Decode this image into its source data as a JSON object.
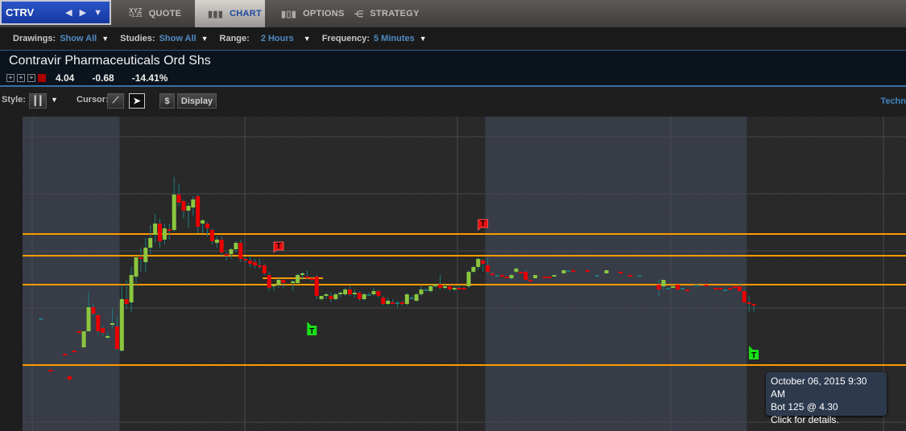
{
  "symbol": "CTRV",
  "tabs": [
    {
      "label": "QUOTE",
      "icon_top": "XYZ",
      "icon_bottom": "+1.21"
    },
    {
      "label": "CHART"
    },
    {
      "label": "OPTIONS"
    },
    {
      "label": "STRATEGY"
    }
  ],
  "toolbar": {
    "drawings_label": "Drawings:",
    "drawings_value": "Show All",
    "studies_label": "Studies:",
    "studies_value": "Show All",
    "range_label": "Range:",
    "range_value": "2 Hours",
    "frequency_label": "Frequency:",
    "frequency_value": "5 Minutes"
  },
  "security": {
    "name": "Contravir Pharmaceuticals Ord Shs",
    "last": "4.04",
    "change": "-0.68",
    "pct_change": "-14.41%"
  },
  "chart_toolbar": {
    "style_label": "Style:",
    "cursor_label": "Cursor:",
    "dollar": "$",
    "display_label": "Display",
    "right_label": "Techn"
  },
  "tooltip": {
    "line1": "October 06, 2015 9:30 AM",
    "line2": "Bot 125 @ 4.30",
    "line3": "Click for details."
  },
  "colors": {
    "up": "#8cc63f",
    "down": "#e80000",
    "wick": "#1d7b7e",
    "level": "#ff9a00",
    "trade_sell": "#e81010",
    "trade_buy": "#19e019"
  },
  "chart_data": {
    "type": "candlestick",
    "frequency_minutes": 5,
    "candles": [
      [
        0,
        3.96,
        3.96,
        3.96,
        3.96
      ],
      [
        2,
        3.64,
        3.64,
        3.64,
        3.64
      ],
      [
        5,
        3.74,
        3.74,
        3.74,
        3.74
      ],
      [
        6,
        3.6,
        3.6,
        3.58,
        3.58
      ],
      [
        7,
        3.76,
        3.76,
        3.76,
        3.76
      ],
      [
        8,
        3.88,
        3.88,
        3.88,
        3.88
      ],
      [
        9,
        3.78,
        3.88,
        3.78,
        3.88
      ],
      [
        10,
        3.88,
        4.13,
        3.88,
        4.03
      ],
      [
        11,
        4.03,
        4.05,
        3.98,
        3.99
      ],
      [
        12,
        3.98,
        3.99,
        3.86,
        3.88
      ],
      [
        13,
        3.9,
        3.91,
        3.85,
        3.87
      ],
      [
        14,
        3.84,
        3.87,
        3.83,
        3.85
      ],
      [
        15,
        3.92,
        4.02,
        3.9,
        3.93
      ],
      [
        16,
        3.91,
        3.97,
        3.76,
        3.77
      ],
      [
        17,
        3.76,
        4.17,
        3.75,
        4.08
      ],
      [
        18,
        4.08,
        4.2,
        4.02,
        4.05
      ],
      [
        19,
        4.06,
        4.28,
        4.0,
        4.23
      ],
      [
        20,
        4.22,
        4.27,
        4.16,
        4.34
      ],
      [
        21,
        4.34,
        4.4,
        4.25,
        4.33
      ],
      [
        22,
        4.31,
        4.46,
        4.25,
        4.4
      ],
      [
        23,
        4.4,
        4.54,
        4.36,
        4.46
      ],
      [
        24,
        4.48,
        4.61,
        4.43,
        4.55
      ],
      [
        25,
        4.55,
        4.58,
        4.4,
        4.44
      ],
      [
        26,
        4.45,
        4.55,
        4.42,
        4.52
      ],
      [
        27,
        4.515,
        4.55,
        4.45,
        4.51
      ],
      [
        28,
        4.51,
        4.84,
        4.5,
        4.73
      ],
      [
        29,
        4.73,
        4.8,
        4.66,
        4.68
      ],
      [
        30,
        4.69,
        4.7,
        4.58,
        4.63
      ],
      [
        31,
        4.63,
        4.68,
        4.52,
        4.66
      ],
      [
        32,
        4.65,
        4.72,
        4.6,
        4.7
      ],
      [
        33,
        4.72,
        4.73,
        4.49,
        4.53
      ],
      [
        34,
        4.55,
        4.58,
        4.49,
        4.57
      ],
      [
        35,
        4.55,
        4.56,
        4.47,
        4.52
      ],
      [
        36,
        4.51,
        4.52,
        4.42,
        4.44
      ],
      [
        37,
        4.43,
        4.47,
        4.4,
        4.45
      ],
      [
        38,
        4.45,
        4.47,
        4.35,
        4.37
      ],
      [
        39,
        4.36,
        4.37,
        4.32,
        4.35
      ],
      [
        40,
        4.36,
        4.4,
        4.33,
        4.39
      ],
      [
        41,
        4.39,
        4.44,
        4.37,
        4.43
      ],
      [
        42,
        4.43,
        4.45,
        4.31,
        4.33
      ],
      [
        43,
        4.33,
        4.34,
        4.31,
        4.32
      ],
      [
        44,
        4.32,
        4.35,
        4.28,
        4.3
      ],
      [
        45,
        4.31,
        4.33,
        4.27,
        4.29
      ],
      [
        46,
        4.29,
        4.33,
        4.27,
        4.28
      ],
      [
        47,
        4.29,
        4.3,
        4.23,
        4.24
      ],
      [
        48,
        4.23,
        4.25,
        4.13,
        4.15
      ],
      [
        49,
        4.16,
        4.17,
        4.13,
        4.17
      ],
      [
        50,
        4.17,
        4.21,
        4.15,
        4.2
      ],
      [
        51,
        4.2,
        4.21,
        4.15,
        4.18
      ],
      [
        53,
        4.18,
        4.2,
        4.13,
        4.19
      ],
      [
        54,
        4.18,
        4.24,
        4.17,
        4.23
      ],
      [
        55,
        4.23,
        4.25,
        4.2,
        4.24
      ],
      [
        56,
        4.22,
        4.26,
        4.2,
        4.21
      ],
      [
        57,
        4.21,
        4.22,
        4.19,
        4.2
      ],
      [
        58,
        4.22,
        4.23,
        4.08,
        4.1
      ],
      [
        59,
        4.08,
        4.1,
        4.07,
        4.1
      ],
      [
        60,
        4.1,
        4.12,
        4.08,
        4.11
      ],
      [
        61,
        4.1,
        4.12,
        4.06,
        4.08
      ],
      [
        62,
        4.08,
        4.12,
        4.07,
        4.11
      ],
      [
        63,
        4.11,
        4.13,
        4.09,
        4.12
      ],
      [
        64,
        4.11,
        4.15,
        4.1,
        4.14
      ],
      [
        65,
        4.14,
        4.16,
        4.1,
        4.11
      ],
      [
        66,
        4.11,
        4.14,
        4.09,
        4.12
      ],
      [
        67,
        4.12,
        4.13,
        4.07,
        4.08
      ],
      [
        68,
        4.08,
        4.12,
        4.07,
        4.11
      ],
      [
        69,
        4.11,
        4.12,
        4.1,
        4.11
      ],
      [
        70,
        4.11,
        4.15,
        4.1,
        4.13
      ],
      [
        71,
        4.13,
        4.14,
        4.09,
        4.1
      ],
      [
        72,
        4.09,
        4.1,
        4.04,
        4.05
      ],
      [
        73,
        4.05,
        4.09,
        4.04,
        4.07
      ],
      [
        74,
        4.06,
        4.08,
        4.05,
        4.06
      ],
      [
        75,
        4.06,
        4.07,
        4.03,
        4.06
      ],
      [
        76,
        4.06,
        4.07,
        4.04,
        4.05
      ],
      [
        77,
        4.05,
        4.12,
        4.04,
        4.11
      ],
      [
        78,
        4.09,
        4.1,
        4.08,
        4.09
      ],
      [
        79,
        4.07,
        4.12,
        4.06,
        4.11
      ],
      [
        80,
        4.11,
        4.16,
        4.1,
        4.14
      ],
      [
        81,
        4.14,
        4.15,
        4.13,
        4.14
      ],
      [
        82,
        4.13,
        4.17,
        4.12,
        4.16
      ],
      [
        83,
        4.16,
        4.18,
        4.15,
        4.17
      ],
      [
        84,
        4.17,
        4.23,
        4.14,
        4.15
      ],
      [
        85,
        4.15,
        4.17,
        4.14,
        4.16
      ],
      [
        86,
        4.16,
        4.17,
        4.13,
        4.14
      ],
      [
        87,
        4.14,
        4.16,
        4.13,
        4.15
      ],
      [
        88,
        4.15,
        4.17,
        4.14,
        4.15
      ],
      [
        89,
        4.15,
        4.16,
        4.14,
        4.15
      ],
      [
        90,
        4.16,
        4.26,
        4.15,
        4.25
      ],
      [
        91,
        4.25,
        4.29,
        4.24,
        4.28
      ],
      [
        92,
        4.28,
        4.34,
        4.26,
        4.33
      ],
      [
        93,
        4.32,
        4.33,
        4.25,
        4.3
      ],
      [
        94,
        4.29,
        4.34,
        4.24,
        4.25
      ],
      [
        95,
        4.24,
        4.25,
        4.24,
        4.24
      ],
      [
        96,
        4.23,
        4.23,
        4.23,
        4.23
      ],
      [
        97,
        4.23,
        4.23,
        4.22,
        4.22
      ],
      [
        98,
        4.22,
        4.22,
        4.21,
        4.21
      ],
      [
        99,
        4.21,
        4.24,
        4.2,
        4.23
      ],
      [
        100,
        4.25,
        4.28,
        4.24,
        4.27
      ],
      [
        101,
        4.25,
        4.25,
        4.25,
        4.25
      ],
      [
        102,
        4.25,
        4.26,
        4.2,
        4.2
      ],
      [
        103,
        4.2,
        4.2,
        4.2,
        4.2
      ],
      [
        104,
        4.21,
        4.23,
        4.21,
        4.23
      ],
      [
        106,
        4.22,
        4.22,
        4.22,
        4.22
      ],
      [
        107,
        4.22,
        4.22,
        4.22,
        4.22
      ],
      [
        108,
        4.22,
        4.23,
        4.22,
        4.23
      ],
      [
        110,
        4.24,
        4.26,
        4.24,
        4.26
      ],
      [
        111,
        4.26,
        4.26,
        4.26,
        4.26
      ],
      [
        112,
        4.26,
        4.26,
        4.26,
        4.26
      ],
      [
        115,
        4.26,
        4.26,
        4.25,
        4.25
      ],
      [
        117,
        4.23,
        4.23,
        4.23,
        4.23
      ],
      [
        119,
        4.24,
        4.26,
        4.24,
        4.26
      ],
      [
        122,
        4.25,
        4.25,
        4.25,
        4.25
      ],
      [
        124,
        4.23,
        4.23,
        4.23,
        4.23
      ],
      [
        126,
        4.23,
        4.23,
        4.23,
        4.23
      ],
      [
        130,
        4.17,
        4.2,
        4.1,
        4.14
      ],
      [
        131,
        4.16,
        4.2,
        4.14,
        4.2
      ],
      [
        132,
        4.15,
        4.15,
        4.15,
        4.15
      ],
      [
        133,
        4.155,
        4.16,
        4.15,
        4.16
      ],
      [
        134,
        4.17,
        4.17,
        4.14,
        4.14
      ],
      [
        135,
        4.15,
        4.15,
        4.15,
        4.15
      ],
      [
        136,
        4.14,
        4.14,
        4.14,
        4.14
      ],
      [
        138,
        4.17,
        4.17,
        4.17,
        4.17
      ],
      [
        140,
        4.17,
        4.17,
        4.17,
        4.17
      ],
      [
        142,
        4.15,
        4.15,
        4.15,
        4.15
      ],
      [
        143,
        4.15,
        4.15,
        4.14,
        4.14
      ],
      [
        144,
        4.14,
        4.14,
        4.14,
        4.14
      ],
      [
        145,
        4.15,
        4.15,
        4.15,
        4.15
      ],
      [
        146,
        4.16,
        4.16,
        4.15,
        4.15
      ],
      [
        147,
        4.16,
        4.18,
        4.13,
        4.13
      ],
      [
        148,
        4.13,
        4.14,
        4.06,
        4.06
      ],
      [
        149,
        4.06,
        4.1,
        4.0,
        4.05
      ],
      [
        150,
        4.05,
        4.05,
        4.0,
        4.04
      ]
    ],
    "levels": [
      4.485,
      4.35,
      4.17,
      3.67
    ],
    "short_level": {
      "price": 4.21,
      "from": 47,
      "to": 59
    },
    "trades": [
      {
        "side": "sell",
        "bar": 50,
        "price": 4.4,
        "label": "T"
      },
      {
        "side": "sell",
        "bar": 93,
        "price": 4.54,
        "label": "T"
      },
      {
        "side": "buy",
        "bar": 57,
        "price": 3.89,
        "label": "T"
      },
      {
        "side": "buy",
        "bar": 150,
        "price": 3.74,
        "label": "T"
      }
    ],
    "shaded_sessions": [
      [
        -4,
        16
      ],
      [
        94,
        148
      ]
    ]
  }
}
